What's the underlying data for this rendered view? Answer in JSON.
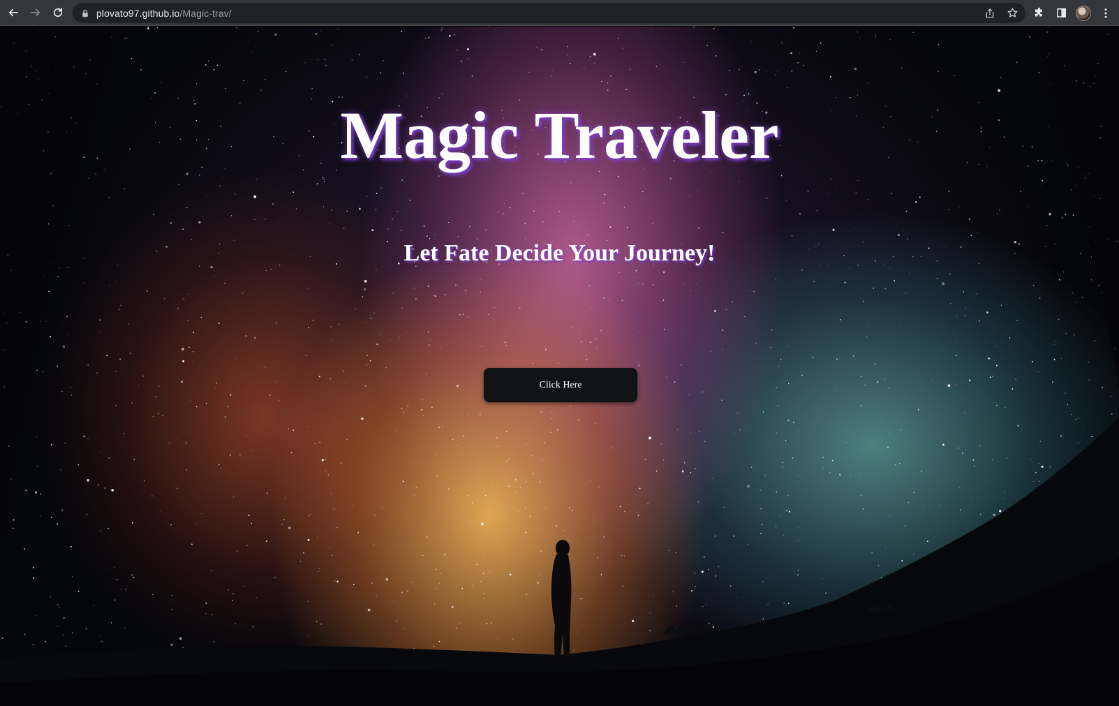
{
  "browser": {
    "url_host": "plovato97.github.io",
    "url_path": "/Magic-trav/",
    "icons": {
      "back": "arrow-left-icon",
      "forward": "arrow-right-icon",
      "reload": "reload-icon",
      "lock": "lock-icon",
      "share": "share-icon",
      "bookmark": "star-icon",
      "extensions": "puzzle-icon",
      "side_panel": "side-panel-icon",
      "profile": "avatar",
      "menu": "kebab-menu-icon"
    }
  },
  "page": {
    "title": "Magic Traveler",
    "subtitle": "Let Fate Decide Your Journey!",
    "button_label": "Click Here",
    "colors": {
      "title_shadow": "#7a3cc8",
      "button_bg": "#111214",
      "text": "#ffffff"
    }
  }
}
